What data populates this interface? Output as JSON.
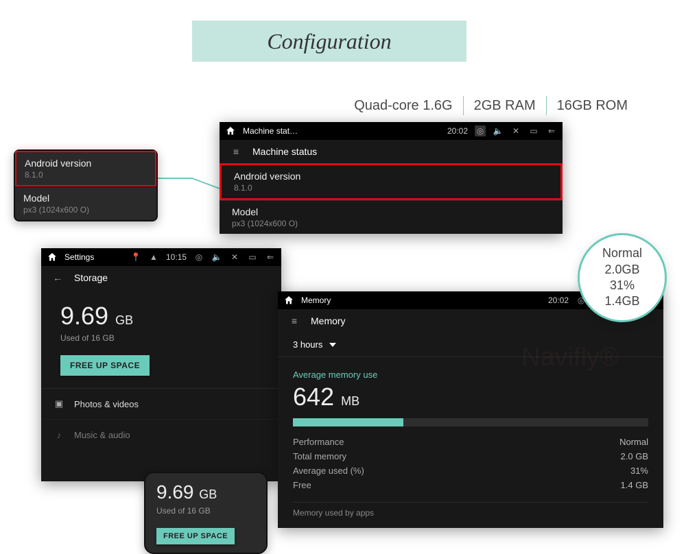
{
  "banner": {
    "title": "Configuration"
  },
  "specs": {
    "cpu": "Quad-core  1.6G",
    "ram": "2GB RAM",
    "rom": "16GB ROM"
  },
  "callout_version": {
    "label": "Android version",
    "value": "8.1.0",
    "model_label": "Model",
    "model_value": "px3 (1024x600 O)"
  },
  "machine_shot": {
    "status_title": "Machine stat…",
    "clock": "20:02",
    "subheader": "Machine status",
    "android_label": "Android version",
    "android_value": "8.1.0",
    "model_label": "Model",
    "model_value": "px3 (1024x600 O)"
  },
  "storage_shot": {
    "status_title": "Settings",
    "clock": "10:15",
    "subheader": "Storage",
    "used_value": "9.69",
    "used_unit": "GB",
    "used_sub": "Used of 16 GB",
    "button": "FREE UP SPACE",
    "cat1": "Photos & videos",
    "cat2": "Music & audio"
  },
  "callout_storage": {
    "value": "9.69",
    "unit": "GB",
    "sub": "Used of 16 GB",
    "button": "FREE UP SPACE"
  },
  "memory_shot": {
    "status_title": "Memory",
    "clock": "20:02",
    "subheader": "Memory",
    "dropdown": "3 hours",
    "avg_label": "Average memory use",
    "avg_value": "642",
    "avg_unit": "MB",
    "used_pct": 31,
    "stats": {
      "perf_label": "Performance",
      "perf_value": "Normal",
      "total_label": "Total memory",
      "total_value": "2.0 GB",
      "avg_label": "Average used (%)",
      "avg_value": "31%",
      "free_label": "Free",
      "free_value": "1.4 GB"
    },
    "footer": "Memory used by apps"
  },
  "circle": {
    "line1": "Normal",
    "line2": "2.0GB",
    "line3": "31%",
    "line4": "1.4GB"
  },
  "watermark": "Navifly®"
}
